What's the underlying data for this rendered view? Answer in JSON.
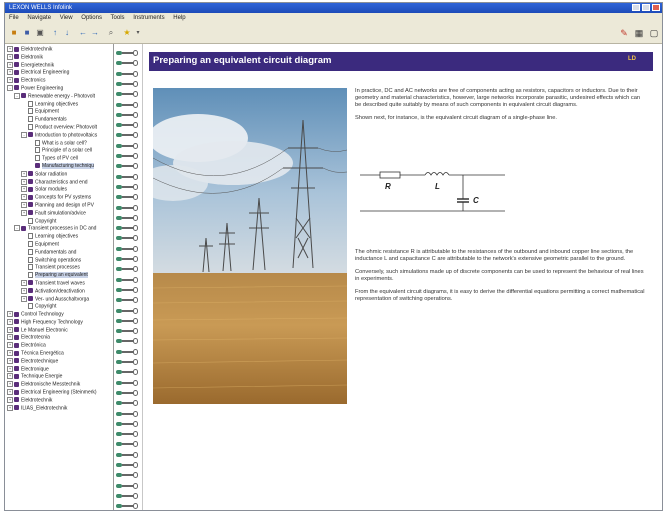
{
  "window": {
    "title": "LEXON WELLS Infolink"
  },
  "menu": [
    "File",
    "Navigate",
    "View",
    "Options",
    "Tools",
    "Instruments",
    "Help"
  ],
  "tree": [
    {
      "label": "Elektrotechnik",
      "depth": 0,
      "toggle": "+",
      "icon": "book"
    },
    {
      "label": "Elektronik",
      "depth": 0,
      "toggle": "+",
      "icon": "book"
    },
    {
      "label": "Energietechnik",
      "depth": 0,
      "toggle": "+",
      "icon": "book"
    },
    {
      "label": "Electrical Engineering",
      "depth": 0,
      "toggle": "+",
      "icon": "book"
    },
    {
      "label": "Electronics",
      "depth": 0,
      "toggle": "+",
      "icon": "book"
    },
    {
      "label": "Power Engineering",
      "depth": 0,
      "toggle": "-",
      "icon": "book"
    },
    {
      "label": "Renewable energy - Photovolt",
      "depth": 1,
      "toggle": "-",
      "icon": "book"
    },
    {
      "label": "Learning objectives",
      "depth": 2,
      "toggle": "",
      "icon": "page"
    },
    {
      "label": "Equipment",
      "depth": 2,
      "toggle": "",
      "icon": "page"
    },
    {
      "label": "Fundamentals",
      "depth": 2,
      "toggle": "",
      "icon": "page"
    },
    {
      "label": "Product overview: Photovolt",
      "depth": 2,
      "toggle": "",
      "icon": "page"
    },
    {
      "label": "Introduction to photovoltaics",
      "depth": 2,
      "toggle": "-",
      "icon": "book"
    },
    {
      "label": "What is a solar cell?",
      "depth": 3,
      "toggle": "",
      "icon": "page"
    },
    {
      "label": "Principle of a solar cell",
      "depth": 3,
      "toggle": "",
      "icon": "page"
    },
    {
      "label": "Types of PV cell",
      "depth": 3,
      "toggle": "",
      "icon": "page"
    },
    {
      "label": "Manufacturing techniqu",
      "depth": 3,
      "toggle": "",
      "icon": "book",
      "selected": true
    },
    {
      "label": "Solar radiation",
      "depth": 2,
      "toggle": "+",
      "icon": "book"
    },
    {
      "label": "Characteristics and end",
      "depth": 2,
      "toggle": "+",
      "icon": "book"
    },
    {
      "label": "Solar modules",
      "depth": 2,
      "toggle": "+",
      "icon": "book"
    },
    {
      "label": "Concepts for PV systems",
      "depth": 2,
      "toggle": "+",
      "icon": "book"
    },
    {
      "label": "Planning and design of PV",
      "depth": 2,
      "toggle": "+",
      "icon": "book"
    },
    {
      "label": "Fault simulation/advice",
      "depth": 2,
      "toggle": "+",
      "icon": "book"
    },
    {
      "label": "Copyright",
      "depth": 2,
      "toggle": "",
      "icon": "page"
    },
    {
      "label": "Transient processes in DC and",
      "depth": 1,
      "toggle": "-",
      "icon": "book"
    },
    {
      "label": "Learning objectives",
      "depth": 2,
      "toggle": "",
      "icon": "page"
    },
    {
      "label": "Equipment",
      "depth": 2,
      "toggle": "",
      "icon": "page"
    },
    {
      "label": "Fundamentals and",
      "depth": 2,
      "toggle": "",
      "icon": "page"
    },
    {
      "label": "Switching operations",
      "depth": 2,
      "toggle": "",
      "icon": "page"
    },
    {
      "label": "Transient processes",
      "depth": 2,
      "toggle": "",
      "icon": "page"
    },
    {
      "label": "Preparing an equivalent",
      "depth": 2,
      "toggle": "",
      "icon": "page",
      "selected": true
    },
    {
      "label": "Transient travel waves",
      "depth": 2,
      "toggle": "+",
      "icon": "book"
    },
    {
      "label": "Activation/deactivation",
      "depth": 2,
      "toggle": "+",
      "icon": "book"
    },
    {
      "label": "Ver- und Ausschaltvorga",
      "depth": 2,
      "toggle": "+",
      "icon": "book"
    },
    {
      "label": "Copyright",
      "depth": 2,
      "toggle": "",
      "icon": "page"
    },
    {
      "label": "Control Technology",
      "depth": 0,
      "toggle": "+",
      "icon": "book"
    },
    {
      "label": "High Frequency Technology",
      "depth": 0,
      "toggle": "+",
      "icon": "book"
    },
    {
      "label": "Le Manuel Electronic",
      "depth": 0,
      "toggle": "+",
      "icon": "book"
    },
    {
      "label": "Electrotecnia",
      "depth": 0,
      "toggle": "+",
      "icon": "book"
    },
    {
      "label": "Electrónica",
      "depth": 0,
      "toggle": "+",
      "icon": "book"
    },
    {
      "label": "Técnica Energética",
      "depth": 0,
      "toggle": "+",
      "icon": "book"
    },
    {
      "label": "Électrotechnique",
      "depth": 0,
      "toggle": "+",
      "icon": "book"
    },
    {
      "label": "Électronique",
      "depth": 0,
      "toggle": "+",
      "icon": "book"
    },
    {
      "label": "Technique Énergie",
      "depth": 0,
      "toggle": "+",
      "icon": "book"
    },
    {
      "label": "Elektronische Messtechnik",
      "depth": 0,
      "toggle": "+",
      "icon": "book"
    },
    {
      "label": "Electrical Engineering (Steinmerk)",
      "depth": 0,
      "toggle": "+",
      "icon": "book"
    },
    {
      "label": "Elektrotechnik",
      "depth": 0,
      "toggle": "+",
      "icon": "book"
    },
    {
      "label": "ILIAS_Elektrotechnik",
      "depth": 0,
      "toggle": "+",
      "icon": "book"
    }
  ],
  "page": {
    "title": "Preparing an equivalent circuit diagram",
    "logo_text": "LD Didactic",
    "paragraphs_top": [
      "In practice, DC and AC networks are free of components acting as resistors, capacitors or inductors. Due to their geometry and material characteristics, however, large networks incorporate parasitic, undesired effects which can be described quite suitably by means of such components in equivalent circuit diagrams.",
      "Shown next, for instance, is the equivalent circuit diagram of a single-phase line."
    ],
    "circuit": {
      "r_label": "R",
      "l_label": "L",
      "c_label": "C"
    },
    "paragraphs_bottom": [
      "The ohmic resistance R is attributable to the resistances of the outbound and inbound copper line sections, the inductance L and capacitance C are attributable to the network's extensive geometric parallel to the ground.",
      "Conversely, such simulations made up of discrete components can be used to represent the behaviour of real lines in experiments.",
      "From the equivalent circuit diagrams, it is easy to derive the differential equations permitting a correct mathematical representation of switching operations."
    ]
  }
}
